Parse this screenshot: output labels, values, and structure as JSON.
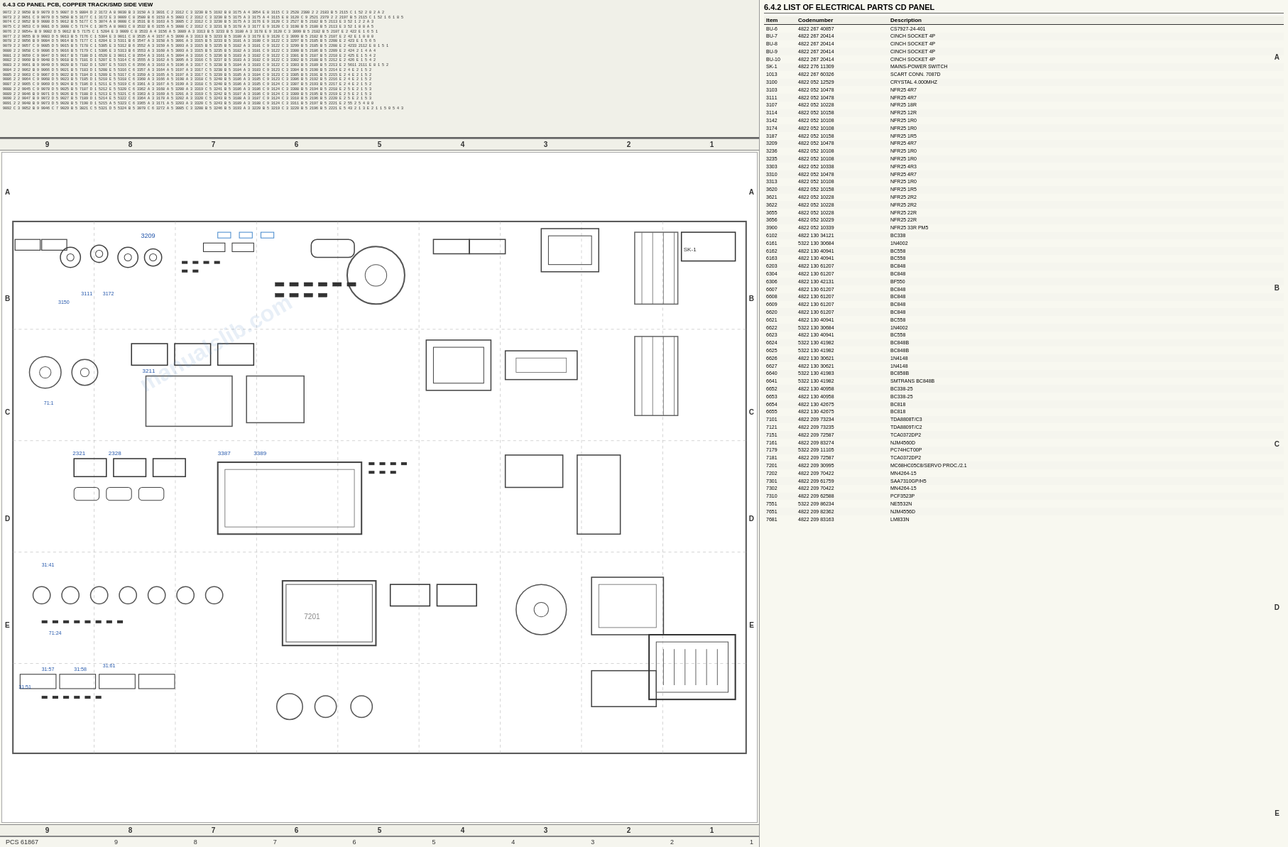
{
  "page": {
    "title": "6.4.3 CD PANEL PCB, COPPER TRACK/SMD SIDE VIEW",
    "parts_title": "6.4.2 LIST OF ELECTRICAL PARTS CD PANEL",
    "pcs_label": "PCS 61867",
    "watermark": "manualslib.com"
  },
  "col_numbers_top": [
    "9",
    "8",
    "7",
    "6",
    "5",
    "4",
    "3",
    "2",
    "1"
  ],
  "col_numbers_bottom": [
    "9",
    "8",
    "7",
    "6",
    "5",
    "4",
    "3",
    "2",
    "1"
  ],
  "row_labels": [
    "A",
    "B",
    "C",
    "D",
    "E"
  ],
  "parts_table": {
    "headers": [
      "Item",
      "Codenumber",
      "Description"
    ],
    "rows": [
      [
        "BU-6",
        "4822 267 40857",
        "CS7927-24-401"
      ],
      [
        "BU-7",
        "4822 267 20414",
        "CINCH SOCKET 4P"
      ],
      [
        "BU-8",
        "4822 267 20414",
        "CINCH SOCKET 4P"
      ],
      [
        "BU-9",
        "4822 267 20414",
        "CINCH SOCKET 4P"
      ],
      [
        "BU-10",
        "4822 267 20414",
        "CINCH SOCKET 4P"
      ],
      [
        "SK-1",
        "4822 276 11309",
        "MAINS-POWER SWITCH"
      ],
      [
        "1013",
        "4822 267 60326",
        "SCART CONN. 7087D"
      ],
      [
        "3100",
        "4822 052 12529",
        "CRYSTAL 4.000MHZ"
      ],
      [
        "3103",
        "4822 052 10478",
        "NFR25 4R7"
      ],
      [
        "3111",
        "4822 052 10478",
        "NFR25 4R7"
      ],
      [
        "3107",
        "4822 052 10228",
        "NFR25 18R"
      ],
      [
        "3114",
        "4822 052 10158",
        "NFR25 12R"
      ],
      [
        "3142",
        "4822 052 10108",
        "NFR25 1R0"
      ],
      [
        "3174",
        "4822 052 10108",
        "NFR25 1R0"
      ],
      [
        "3187",
        "4822 052 10158",
        "NFR25 1R5"
      ],
      [
        "3209",
        "4822 052 10478",
        "NFR25 4R7"
      ],
      [
        "3236",
        "4822 052 10108",
        "NFR25 1R0"
      ],
      [
        "3235",
        "4822 052 10108",
        "NFR25 1R0"
      ],
      [
        "3303",
        "4822 052 10338",
        "NFR25 4R3"
      ],
      [
        "3310",
        "4822 052 10478",
        "NFR25 4R7"
      ],
      [
        "3313",
        "4822 052 10108",
        "NFR25 1R0"
      ],
      [
        "3620",
        "4822 052 10158",
        "NFR25 1R5"
      ],
      [
        "3621",
        "4822 052 10228",
        "NFR25 2R2"
      ],
      [
        "3622",
        "4822 052 10228",
        "NFR25 2R2"
      ],
      [
        "3655",
        "4822 052 10228",
        "NFR25 22R"
      ],
      [
        "3656",
        "4822 052 10229",
        "NFR25 22R"
      ],
      [
        "3900",
        "4822 052 10339",
        "NFR25 33R PM5"
      ],
      [
        "6102",
        "4822 130 34121",
        "BC338"
      ],
      [
        "6161",
        "5322 130 30684",
        "1N4002"
      ],
      [
        "6162",
        "4822 130 40941",
        "BC558"
      ],
      [
        "6163",
        "4822 130 40941",
        "BC558"
      ],
      [
        "6203",
        "4822 130 61207",
        "BC848"
      ],
      [
        "6304",
        "4822 130 61207",
        "BC848"
      ],
      [
        "6306",
        "4822 130 42131",
        "BF550"
      ],
      [
        "6607",
        "4822 130 61207",
        "BC848"
      ],
      [
        "6608",
        "4822 130 61207",
        "BC848"
      ],
      [
        "6609",
        "4822 130 61207",
        "BC848"
      ],
      [
        "6620",
        "4822 130 61207",
        "BC848"
      ],
      [
        "6621",
        "4822 130 40941",
        "BC558"
      ],
      [
        "6622",
        "5322 130 30684",
        "1N4002"
      ],
      [
        "6623",
        "4822 130 40941",
        "BC558"
      ],
      [
        "6624",
        "5322 130 41982",
        "BC848B"
      ],
      [
        "6625",
        "5322 130 41982",
        "BC848B"
      ],
      [
        "6626",
        "4822 130 30621",
        "1N4148"
      ],
      [
        "6627",
        "4822 130 30621",
        "1N4148"
      ],
      [
        "6640",
        "5322 130 41983",
        "BC858B"
      ],
      [
        "6641",
        "5322 130 41982",
        "SMTRANS BC848B"
      ],
      [
        "6652",
        "4822 130 40958",
        "BC338-25"
      ],
      [
        "6653",
        "4822 130 40958",
        "BC338-25"
      ],
      [
        "6654",
        "4822 130 42675",
        "BC818"
      ],
      [
        "6655",
        "4822 130 42675",
        "BC818"
      ],
      [
        "7101",
        "4822 209 73234",
        "TDA8808T/C3"
      ],
      [
        "7121",
        "4822 209 73235",
        "TDA8809T/C2"
      ],
      [
        "7151",
        "4822 209 72587",
        "TCA0372DP2"
      ],
      [
        "7161",
        "4822 209 83274",
        "NJM4560D"
      ],
      [
        "7179",
        "5322 209 11105",
        "PC74HCT00P"
      ],
      [
        "7181",
        "4822 209 72587",
        "TCA0372DP2"
      ],
      [
        "7201",
        "4822 209 30995",
        "MC68HC05C8/SERVO PROC./2.1"
      ],
      [
        "7202",
        "4822 209 70422",
        "MN4264-15"
      ],
      [
        "7301",
        "4822 209 61759",
        "SAA7310GP/H5"
      ],
      [
        "7302",
        "4822 209 70422",
        "MN4264-15"
      ],
      [
        "7310",
        "4822 209 62588",
        "PCF3523P"
      ],
      [
        "7551",
        "5322 209 86234",
        "NE5532N"
      ],
      [
        "7651",
        "4822 209 82362",
        "NJM4556D"
      ],
      [
        "7681",
        "4822 209 83163",
        "LM833N"
      ]
    ]
  },
  "netlist_title": "6.4.3 CD PANEL PCB, COPPER TRACK/SMD SIDE VIEW",
  "netlist_data": [
    "9072 2 2  9050 B 9  9079 D 5  9087 D 5  8804 D 2  3172 A 8  9030 B 3  3150 A 3  3031 C 2  3312 C 3  3230 B 5  3192 B 8  3175 A 4  3054 E 8  3115 C 3  2528 2380 2 2  2183 B 5  2115 C 1  52 2 0  2 A 2",
    "9073 2 2  9051 C 9  9079 D 5  5050 B 5  3177 C 1  3172 E 3  9009 C 8  3580 B 6  3153 A 5  3083 C 2  3312 C 3  3230 B 5  3175 A 3  3175 A 4  3115 E 8  3120 C 9  2521 2379 2 2  2197 B 5  2115 C 1  52 1 6  1 8 5",
    "9074 C 2  9052 B 9  9080 D 5  9012 B 5  5177 C 5  3074 A 8  9008 C 8  3531 B 6  3163 A 5  3085 C 2  3312 C 3  3230 B 5  3175 A 3  3176 E 9  3120 C 3  2527 B 5  2182 B 5  2113 E 3  52 1 2  2 A 3",
    "9075 C 2  9053 C 9  9081 D 5  3008 C 5  7174 C 1  3075 A 8  9003 C 8  3532 B 6  3155 A 5  3088 C 2  3312 C 3  3231 B 5  3178 A 3  3177 E 9  3120 C 3  3198 B 5  2180 B 5  2113 E 3  52 1 8  8 A 5",
    "9076 2 2  9054+ B 9  9082 D 5  9012 B 5  7175 C 1  5204 E 3  9009 C 8  3533 A 4  3156 A 5  3089 A 3  3313 B 5  3233 B 5  3180 A 3  3178 E 9  3120 C 3  3099 B 5  2182 B 5  2107 E 2  422 E 1  6 5 1",
    "9077 2 2  9055 B 9  9083 D 5  9013 B 5  7176 C 1  5304 E 3  9011 C 8  3535 A 4  3157 A 5  3090 A 3  3313 B 5  3233 B 5  3180 A 3  3179 E 9  3120 C 3  3099 B 5  2182 B 5  2107 E 2  42 E 1  0 0 0",
    "9078 2 2  9056 B 9  9084 D 5  9014 B 5  7177 C 1  6204 E 3  5311 B 6  3547 A 3  3158 A 5  3091 A 3  3315 B 5  3233 B 5  3181 A 3  3180 C 9  3122 C 3  3297 B 5  2185 B 5  2208 E 2  423 E 1  5 6 5",
    "9079 2 2  9057 C 9  9085 D 5  9015 B 5  7178 C 1  5305 E 3  5312 B 6  3552 A 3  3159 A 5  3093 A 3  3315 B 5  3235 B 5  3182 A 3  3181 C 9  3122 C 3  3299 B 5  2185 B 5  2208 E 2  4233 2112 E 8  1 5 1",
    "9080 2 2  9058 C 9  9086 D 5  9016 B 5  7179 C 1  5306 E 3  5313 B 6  3553 A 3  3160 A 5  3093 A 3  3315 B 5  3235 B 5  3182 A 3  3181 C 9  3122 C 3  3300 B 5  2186 B 5  2209 E 2  424 2 1  4 A 4",
    "9081 2 2  9059 C 9  9047 D 5  9017 B 5  7180 D 1  6520 E 3  9011 C 8  3554 A 3  3161 A 5  3094 A 3  3316 C 5  3236 B 5  3183 A 3  3182 C 9  3122 C 3  3301 B 5  2187 B 5  2210 E 2  425 E 1  5 4 2",
    "9082 2 2  9060 B 9  9048 D 5  9018 B 5  7181 D 1  5207 E 5  5314 C 6  3555 A 3  3162 A 5  3095 A 3  3316 C 5  3237 B 5  3183 A 3  3182 C 9  3122 C 3  3302 B 5  2188 B 5  2212 E 2  426 E 1  5 4 2",
    "9083 2 2  9061 B 9  9049 D 5  9020 B 5  7182 D 1  5207 E 5  5315 C 6  3556 A 3  3163 A 5  3196 A 3  3317 C 5  3238 B 5  3184 A 3  3183 C 9  3122 C 3  3303 B 5  2189 B 5  2213 E 2  5611 2111 E 8  1 5 2",
    "9084 2 2  9062 B 9  9066 D 5  9021 B 5  7183 D 1  5208 E 5  5316 C 6  3357 A 3  3164 A 5  3197 A 3  3317 C 5  3238 B 5  3184 A 3  3183 C 9  3123 C 3  3304 B 5  2190 B 5  2214 E 2  4 E 2  1 5 2",
    "9085 2 2  9063 C 9  9067 D 5  9022 B 5  7184 D 1  5209 E 5  5317 C 6  3359 A 3  3165 A 5  3197 A 3  3317 C 5  3239 B 5  3185 A 3  3184 C 9  3123 C 3  3305 B 5  2191 B 5  2215 E 2  4 E 2  1 5 2",
    "9086 2 2  9064 C 9  9068 D 5  9023 B 5  7185 D 1  5210 E 5  5318 C 6  3360 A 3  3166 A 5  3198 A 3  3318 C 5  3240 B 5  3186 A 3  3185 C 9  3123 C 3  3306 B 5  2192 B 5  2216 E 2  4 E 2  1 5 2",
    "9087 2 2  9065 C 9  9069 D 5  9024 B 5  7186 D 1  5211 E 5  5319 C 6  3361 A 3  3167 A 5  3199 A 3  3318 C 5  3240 B 5  3186 A 3  3185 C 9  3124 C 3  3307 B 5  2193 B 5  2217 E 2  4 E 2  1 5 2",
    "9088 2 2  9045 C 9  9070 D 5  9025 B 5  7187 D 1  5212 E 5  5320 C 6  3362 A 3  3168 A 5  3200 A 3  3319 C 5  3241 B 5  3186 A 3  3186 C 9  3124 C 3  3308 B 5  2194 B 5  2218 E 2  5 E 2  1 5 3",
    "9089 2 2  9046 B 9  9071 D 5  9026 B 5  7188 D 1  5213 E 5  5321 C 6  3363 A 3  3169 A 5  3201 A 3  3319 C 5  3242 B 5  3187 A 3  3186 C 9  3124 C 3  3309 B 5  2195 B 5  2219 E 2  5 E 2  1 5 3",
    "9090 2 2  9047 B 9  9072 D 5  9027 B 5  7189 D 1  5214 E 5  5322 C 6  3364 A 3  3170 A 5  3202 A 3  3320 C 5  3243 B 5  3188 A 3  3187 C 9  3124 C 3  3310 B 5  2196 B 5  2220 E 2  5 E 2  1 5 3",
    "9091 2 2  9048 B 9  9073 D 5  9028 B 5  7190 D 1  5215 A 5  5323 C 6  3365 A 3  3171 A 5  3203 A 3  3320 C 5  3243 B 5  3189 A 3  3188 C 9  3124 C 3  3311 B 5  2197 B 5  2221 E 2  55 2 5  4 8 0",
    "9092 C 3  9052 B 9  9046 C 7  9029 B 5  3821 C 5  5321 D 5  5324 B 5  3070 C 6  3272 A 5  3085 C 3  3208 B 5  3246 B 5  3193 A 3  3220 B 5  3219 C 3  3220 B 5  2196 B 5  2221 E 5  43 2 1  3 E 2  1 1 5 0 5 4 3"
  ]
}
